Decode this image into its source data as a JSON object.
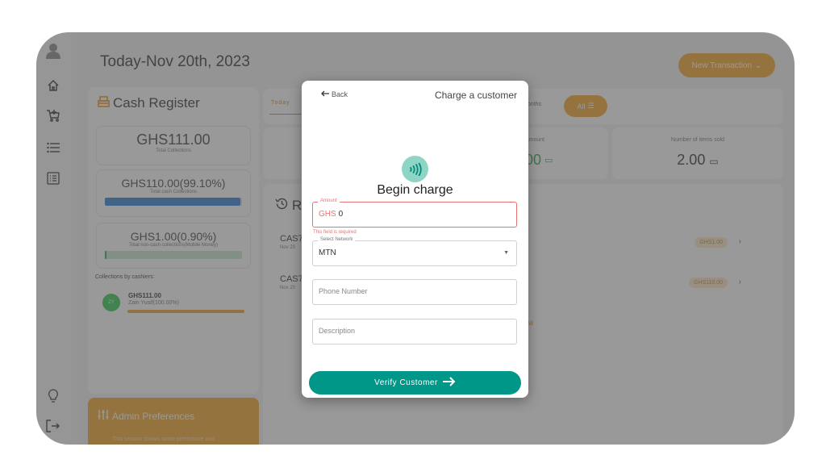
{
  "app": {
    "title": "Today-Nov 20th, 2023",
    "new_transaction_label": "New Transaction"
  },
  "sidebar": {
    "icons": [
      "avatar-icon",
      "home-icon",
      "cart-add-icon",
      "list-icon",
      "report-icon",
      "lightbulb-icon",
      "logout-icon"
    ]
  },
  "cash_register": {
    "title": "Cash Register",
    "total": {
      "amount": "GHS111.00",
      "label": "Total Collections"
    },
    "cash": {
      "amount": "GHS110.00(99.10%)",
      "label": "Total cash Collections",
      "percent": 99.1,
      "color": "#2b7fd4"
    },
    "noncash": {
      "amount": "GHS1.00(0.90%)",
      "label": "Total non-cash collections(Mobile Money)",
      "percent": 0.9,
      "color": "#2fa84f"
    },
    "collections_by_cashiers_label": "Collections by cashiers:",
    "cashiers": [
      {
        "initials": "ZY",
        "amount": "GHS111.00",
        "name": "Zain Yusif(100.00%)",
        "percent": 100
      }
    ]
  },
  "admin": {
    "title": "Admin Preferences",
    "description": "This section shows some preference and"
  },
  "filters": {
    "today_label": "Today",
    "months_label": "Months",
    "all_label": "All"
  },
  "metrics": {
    "amount_label": "Amount",
    "amount_value": ".00",
    "items_sold_label": "Number of items sold",
    "items_sold_value": "2.00"
  },
  "recent": {
    "title": "R",
    "view_all_label": "All",
    "transactions": [
      {
        "code": "CAS7",
        "date": "Nov 20",
        "amount": "GHS1.00"
      },
      {
        "code": "CAS7",
        "date": "Nov 20",
        "amount": "GHS110.00"
      }
    ]
  },
  "modal": {
    "back_label": "Back",
    "title": "Charge a customer",
    "heading": "Begin charge",
    "amount": {
      "label": "Amount",
      "prefix": "GHS",
      "value": "0",
      "error": "This field is required"
    },
    "network": {
      "label": "Select Network",
      "value": "MTN"
    },
    "phone": {
      "placeholder": "Phone Number"
    },
    "description": {
      "placeholder": "Description"
    },
    "verify_label": "Verify Customer",
    "accent": "#009688"
  }
}
